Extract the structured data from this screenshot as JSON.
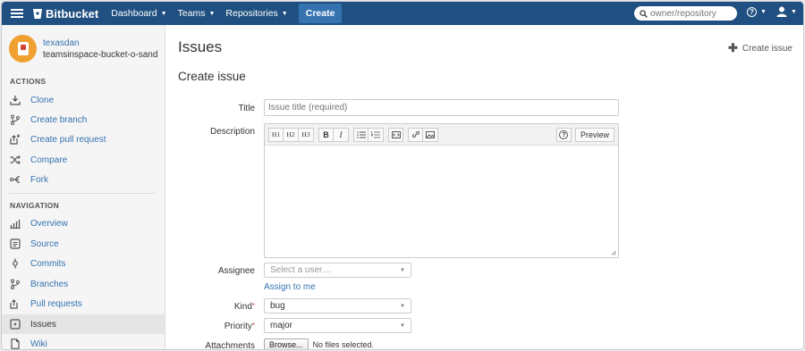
{
  "topnav": {
    "brand": "Bitbucket",
    "items": [
      {
        "label": "Dashboard"
      },
      {
        "label": "Teams"
      },
      {
        "label": "Repositories"
      }
    ],
    "create_label": "Create",
    "search_placeholder": "owner/repository",
    "accent": "#205081"
  },
  "sidebar": {
    "owner": "texasdan",
    "repo": "teamsinspace-bucket-o-sand",
    "actions_heading": "ACTIONS",
    "actions": [
      {
        "label": "Clone",
        "icon": "clone-icon"
      },
      {
        "label": "Create branch",
        "icon": "branch-icon"
      },
      {
        "label": "Create pull request",
        "icon": "pull-request-icon"
      },
      {
        "label": "Compare",
        "icon": "compare-icon"
      },
      {
        "label": "Fork",
        "icon": "fork-icon"
      }
    ],
    "navigation_heading": "NAVIGATION",
    "navigation": [
      {
        "label": "Overview",
        "icon": "overview-icon"
      },
      {
        "label": "Source",
        "icon": "source-icon"
      },
      {
        "label": "Commits",
        "icon": "commits-icon"
      },
      {
        "label": "Branches",
        "icon": "branches-icon"
      },
      {
        "label": "Pull requests",
        "icon": "pull-requests-icon"
      },
      {
        "label": "Issues",
        "icon": "issues-icon",
        "active": true
      },
      {
        "label": "Wiki",
        "icon": "wiki-icon"
      }
    ]
  },
  "main": {
    "title": "Issues",
    "create_issue_link": "Create issue",
    "form_title": "Create issue",
    "title_label": "Title",
    "title_placeholder": "Issue title (required)",
    "description_label": "Description",
    "toolbar": {
      "h1": "H1",
      "h2": "H2",
      "h3": "H3",
      "bold": "B",
      "italic": "I",
      "help": "?",
      "preview": "Preview"
    },
    "assignee_label": "Assignee",
    "assignee_placeholder": "Select a user…",
    "assign_to_me": "Assign to me",
    "kind_label": "Kind",
    "kind_value": "bug",
    "priority_label": "Priority",
    "priority_value": "major",
    "attachments_label": "Attachments",
    "browse_label": "Browse...",
    "no_files": "No files selected."
  }
}
